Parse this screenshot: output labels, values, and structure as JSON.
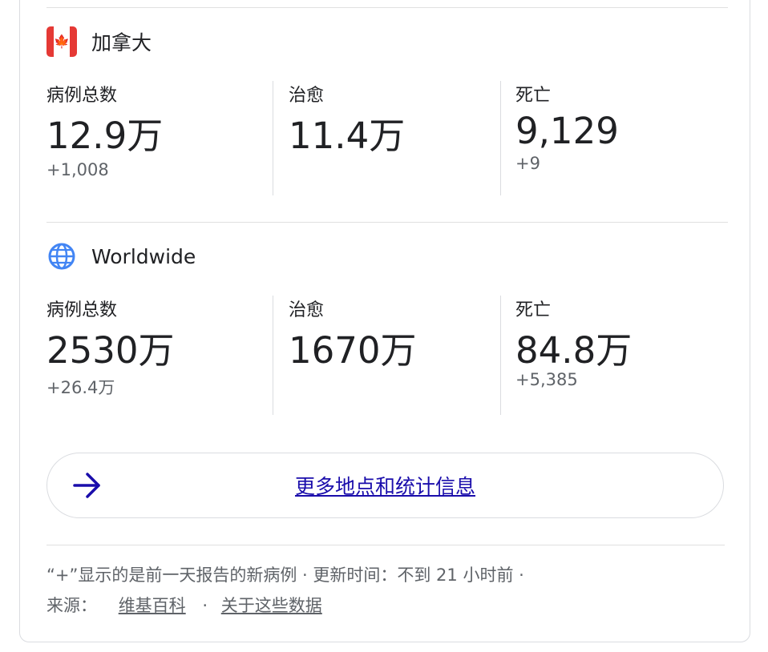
{
  "canada": {
    "name": "加拿大",
    "stats": [
      {
        "label": "病例总数",
        "value": "12.9万",
        "delta": "+1,008"
      },
      {
        "label": "治愈",
        "value": "11.4万",
        "delta": ""
      },
      {
        "label": "死亡",
        "value": "9,129",
        "delta": "+9"
      }
    ]
  },
  "worldwide": {
    "name": "Worldwide",
    "stats": [
      {
        "label": "病例总数",
        "value": "2530万",
        "delta": "+26.4万"
      },
      {
        "label": "治愈",
        "value": "1670万",
        "delta": ""
      },
      {
        "label": "死亡",
        "value": "84.8万",
        "delta": "+5,385"
      }
    ]
  },
  "more": {
    "label": "更多地点和统计信息"
  },
  "footer": {
    "note": "“+”显示的是前一天报告的新病例 · 更新时间：不到 21 小时前 ·",
    "source_label": "来源：",
    "source_link": "维基百科",
    "separator": "·",
    "about_link": "关于这些数据"
  },
  "colors": {
    "link": "#1a0dab",
    "flag_red": "#e53935",
    "globe_blue": "#4285f4"
  }
}
